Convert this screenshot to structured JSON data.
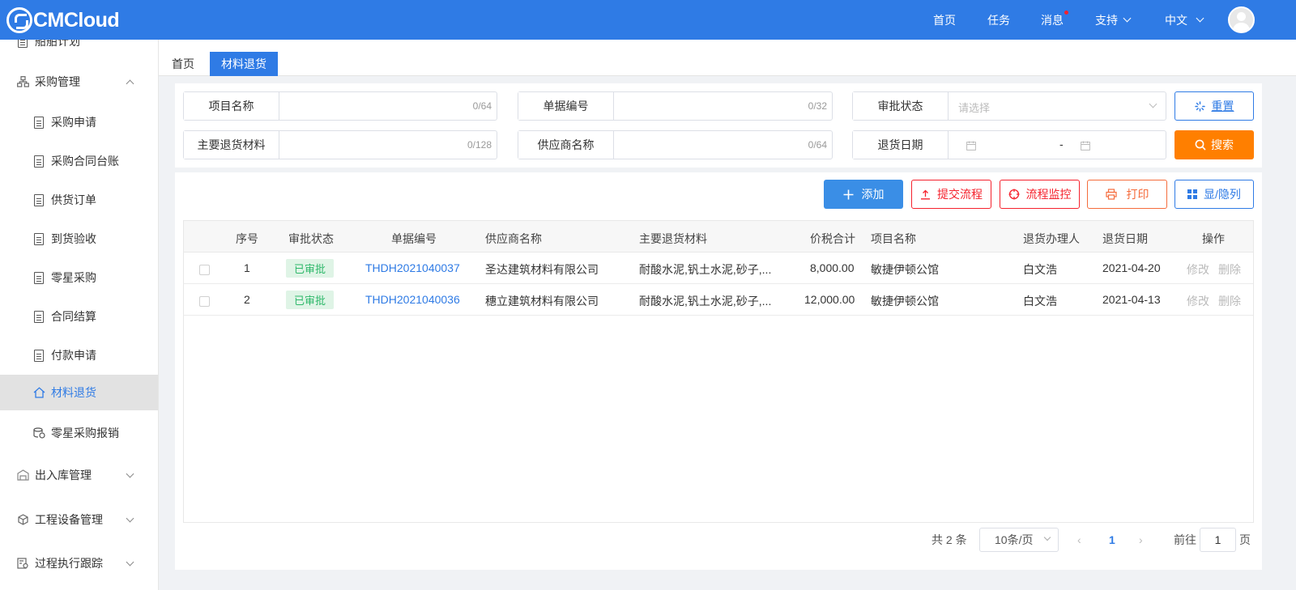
{
  "topbar": {
    "logo_text": "CMCloud",
    "nav": [
      "首页",
      "任务",
      "消息",
      "支持",
      "中文"
    ]
  },
  "sidebar": {
    "partial_label": "船舶计划",
    "groups": [
      {
        "label": "采购管理"
      },
      {
        "label": "出入库管理"
      },
      {
        "label": "工程设备管理"
      },
      {
        "label": "过程执行跟踪"
      }
    ],
    "items": [
      {
        "label": "采购申请"
      },
      {
        "label": "采购合同台账"
      },
      {
        "label": "供货订单"
      },
      {
        "label": "到货验收"
      },
      {
        "label": "零星采购"
      },
      {
        "label": "合同结算"
      },
      {
        "label": "付款申请"
      },
      {
        "label": "材料退货"
      },
      {
        "label": "零星采购报销"
      }
    ]
  },
  "tabs": [
    {
      "label": "首页"
    },
    {
      "label": "材料退货"
    }
  ],
  "filters": {
    "project_name": {
      "label": "项目名称",
      "value": "",
      "count": "0/64"
    },
    "doc_no": {
      "label": "单据编号",
      "value": "",
      "count": "0/32"
    },
    "approval_status": {
      "label": "审批状态",
      "placeholder": "请选择"
    },
    "main_material": {
      "label": "主要退货材料",
      "value": "",
      "count": "0/128"
    },
    "supplier": {
      "label": "供应商名称",
      "value": "",
      "count": "0/64"
    },
    "return_date": {
      "label": "退货日期",
      "separator": "-"
    },
    "reset_label": "重置",
    "search_label": "搜索"
  },
  "toolbar": {
    "add": "添加",
    "submit_flow": "提交流程",
    "flow_monitor": "流程监控",
    "print": "打印",
    "toggle_columns": "显/隐列"
  },
  "table": {
    "headers": [
      "序号",
      "审批状态",
      "单据编号",
      "供应商名称",
      "主要退货材料",
      "价税合计",
      "项目名称",
      "退货办理人",
      "退货日期",
      "操作"
    ],
    "rows": [
      {
        "index": "1",
        "status": "已审批",
        "doc_no": "THDH2021040037",
        "supplier": "圣达建筑材料有限公司",
        "material": "耐酸水泥,钒土水泥,砂子,...",
        "amount": "8,000.00",
        "project": "敏捷伊顿公馆",
        "handler": "白文浩",
        "date": "2021-04-20",
        "edit": "修改",
        "delete": "删除"
      },
      {
        "index": "2",
        "status": "已审批",
        "doc_no": "THDH2021040036",
        "supplier": "穗立建筑材料有限公司",
        "material": "耐酸水泥,钒土水泥,砂子,...",
        "amount": "12,000.00",
        "project": "敏捷伊顿公馆",
        "handler": "白文浩",
        "date": "2021-04-13",
        "edit": "修改",
        "delete": "删除"
      }
    ]
  },
  "pagination": {
    "total": "共 2 条",
    "page_size": "10条/页",
    "current_page": "1",
    "goto_label": "前往",
    "goto_value": "1",
    "page_suffix": "页"
  },
  "colors": {
    "primary": "#2f7be5",
    "orange": "#ff7f00",
    "danger": "#f5222d",
    "danger_light": "#f56c6c",
    "success_bg": "#dff4e6",
    "success_text": "#2eb86a"
  }
}
